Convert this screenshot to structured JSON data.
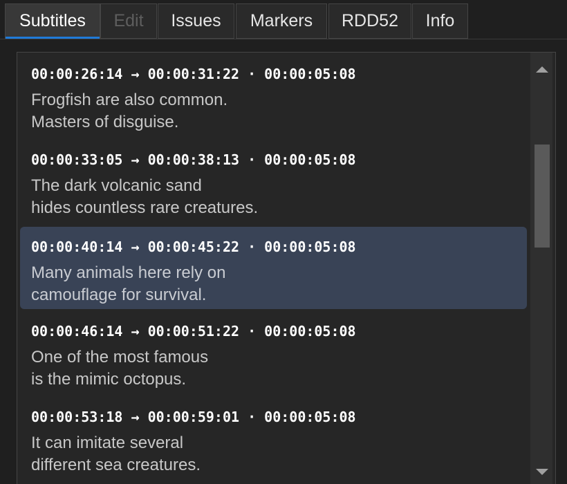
{
  "tabs": [
    {
      "label": "Subtitles",
      "state": "active"
    },
    {
      "label": "Edit",
      "state": "disabled"
    },
    {
      "label": "Issues",
      "state": "normal"
    },
    {
      "label": "Markers",
      "state": "normal"
    },
    {
      "label": "RDD52",
      "state": "normal"
    },
    {
      "label": "Info",
      "state": "normal"
    }
  ],
  "subtitles": [
    {
      "timecode": "00:00:26:14 → 00:00:31:22 · 00:00:05:08",
      "line1": "Frogfish are also common.",
      "line2": "Masters of disguise.",
      "selected": false
    },
    {
      "timecode": "00:00:33:05 → 00:00:38:13 · 00:00:05:08",
      "line1": "The dark volcanic sand",
      "line2": "hides countless rare creatures.",
      "selected": false
    },
    {
      "timecode": "00:00:40:14 → 00:00:45:22 · 00:00:05:08",
      "line1": "Many animals here rely on",
      "line2": "camouflage for survival.",
      "selected": true
    },
    {
      "timecode": "00:00:46:14 → 00:00:51:22 · 00:00:05:08",
      "line1": "One of the most famous",
      "line2": "is the mimic octopus.",
      "selected": false
    },
    {
      "timecode": "00:00:53:18 → 00:00:59:01 · 00:00:05:08",
      "line1": "It can imitate several",
      "line2": "different sea creatures.",
      "selected": false
    }
  ],
  "colors": {
    "accent": "#1f7ad8",
    "selected_row": "#394356",
    "background": "#1f1f1f"
  },
  "icons": {
    "scroll_up": "triangle-up-icon",
    "scroll_down": "triangle-down-icon"
  }
}
